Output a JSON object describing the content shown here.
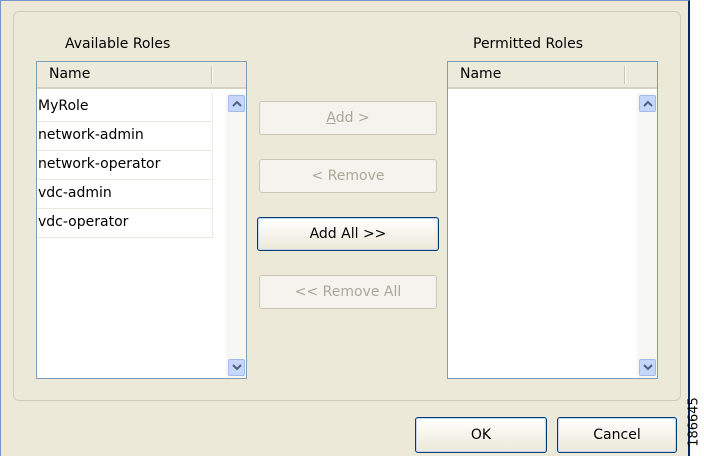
{
  "available": {
    "title": "Available Roles",
    "column": "Name",
    "items": [
      "MyRole",
      "network-admin",
      "network-operator",
      "vdc-admin",
      "vdc-operator"
    ]
  },
  "permitted": {
    "title": "Permitted Roles",
    "column": "Name",
    "items": []
  },
  "buttons": {
    "add_mnemonic": "A",
    "add_rest": "dd >",
    "remove": "< Remove",
    "add_all": "Add All >>",
    "remove_all": "<< Remove All",
    "ok": "OK",
    "cancel": "Cancel"
  },
  "figure_id": "186645"
}
